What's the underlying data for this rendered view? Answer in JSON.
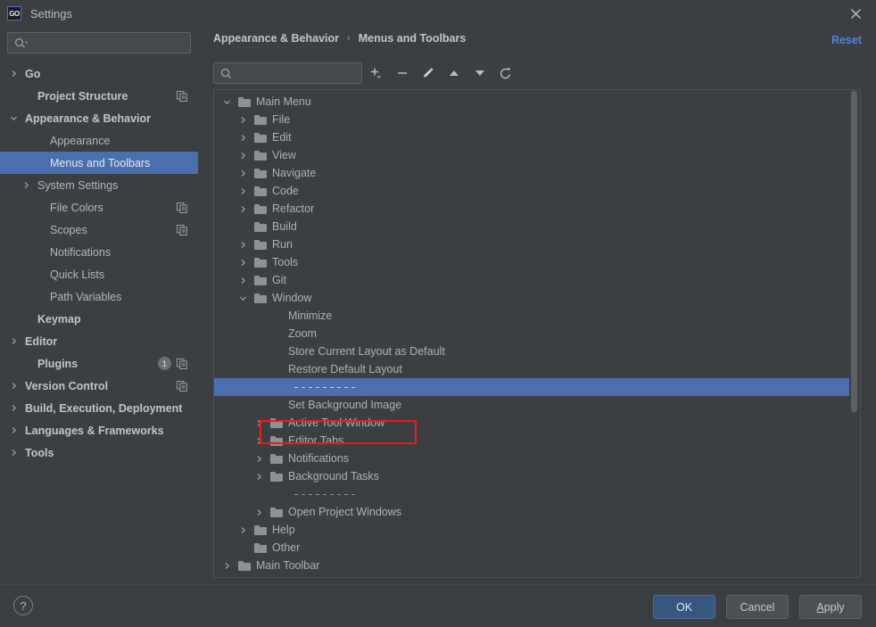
{
  "window": {
    "title": "Settings",
    "app_icon": "GO",
    "close_icon": "close-icon"
  },
  "sidebar": {
    "search": {
      "placeholder": "",
      "value": "",
      "icon": "search-icon"
    },
    "items": [
      {
        "label": "Go",
        "chevron": "right",
        "bold": true,
        "indent": 0,
        "selected": false,
        "copy": false,
        "badge": null
      },
      {
        "label": "Project Structure",
        "chevron": "none",
        "bold": true,
        "indent": 1,
        "selected": false,
        "copy": true,
        "badge": null
      },
      {
        "label": "Appearance & Behavior",
        "chevron": "down",
        "bold": true,
        "indent": 0,
        "selected": false,
        "copy": false,
        "badge": null
      },
      {
        "label": "Appearance",
        "chevron": "none",
        "bold": false,
        "indent": 2,
        "selected": false,
        "copy": false,
        "badge": null
      },
      {
        "label": "Menus and Toolbars",
        "chevron": "none",
        "bold": false,
        "indent": 2,
        "selected": true,
        "copy": false,
        "badge": null
      },
      {
        "label": "System Settings",
        "chevron": "right",
        "bold": false,
        "indent": 1,
        "selected": false,
        "copy": false,
        "badge": null
      },
      {
        "label": "File Colors",
        "chevron": "none",
        "bold": false,
        "indent": 2,
        "selected": false,
        "copy": true,
        "badge": null
      },
      {
        "label": "Scopes",
        "chevron": "none",
        "bold": false,
        "indent": 2,
        "selected": false,
        "copy": true,
        "badge": null
      },
      {
        "label": "Notifications",
        "chevron": "none",
        "bold": false,
        "indent": 2,
        "selected": false,
        "copy": false,
        "badge": null
      },
      {
        "label": "Quick Lists",
        "chevron": "none",
        "bold": false,
        "indent": 2,
        "selected": false,
        "copy": false,
        "badge": null
      },
      {
        "label": "Path Variables",
        "chevron": "none",
        "bold": false,
        "indent": 2,
        "selected": false,
        "copy": false,
        "badge": null
      },
      {
        "label": "Keymap",
        "chevron": "none",
        "bold": true,
        "indent": 1,
        "selected": false,
        "copy": false,
        "badge": null
      },
      {
        "label": "Editor",
        "chevron": "right",
        "bold": true,
        "indent": 0,
        "selected": false,
        "copy": false,
        "badge": null
      },
      {
        "label": "Plugins",
        "chevron": "none",
        "bold": true,
        "indent": 1,
        "selected": false,
        "copy": true,
        "badge": "1"
      },
      {
        "label": "Version Control",
        "chevron": "right",
        "bold": true,
        "indent": 0,
        "selected": false,
        "copy": true,
        "badge": null
      },
      {
        "label": "Build, Execution, Deployment",
        "chevron": "right",
        "bold": true,
        "indent": 0,
        "selected": false,
        "copy": false,
        "badge": null
      },
      {
        "label": "Languages & Frameworks",
        "chevron": "right",
        "bold": true,
        "indent": 0,
        "selected": false,
        "copy": false,
        "badge": null
      },
      {
        "label": "Tools",
        "chevron": "right",
        "bold": true,
        "indent": 0,
        "selected": false,
        "copy": false,
        "badge": null
      }
    ]
  },
  "main": {
    "breadcrumb": {
      "root": "Appearance & Behavior",
      "separator": "›",
      "current": "Menus and Toolbars"
    },
    "reset_label": "Reset",
    "toolbar": {
      "search": {
        "placeholder": "",
        "value": "",
        "icon": "search-icon"
      },
      "buttons": [
        {
          "name": "add-button",
          "icon": "plus-dropdown-icon"
        },
        {
          "name": "remove-button",
          "icon": "minus-icon"
        },
        {
          "name": "edit-button",
          "icon": "pencil-icon"
        },
        {
          "name": "move-up-button",
          "icon": "arrow-up-icon"
        },
        {
          "name": "move-down-button",
          "icon": "arrow-down-icon"
        },
        {
          "name": "restore-button",
          "icon": "revert-icon"
        }
      ]
    },
    "tree": [
      {
        "label": "Main Menu",
        "chevron": "down",
        "indent": 0,
        "folder": true,
        "separator": false,
        "selected": false
      },
      {
        "label": "File",
        "chevron": "right",
        "indent": 1,
        "folder": true,
        "separator": false,
        "selected": false
      },
      {
        "label": "Edit",
        "chevron": "right",
        "indent": 1,
        "folder": true,
        "separator": false,
        "selected": false
      },
      {
        "label": "View",
        "chevron": "right",
        "indent": 1,
        "folder": true,
        "separator": false,
        "selected": false
      },
      {
        "label": "Navigate",
        "chevron": "right",
        "indent": 1,
        "folder": true,
        "separator": false,
        "selected": false
      },
      {
        "label": "Code",
        "chevron": "right",
        "indent": 1,
        "folder": true,
        "separator": false,
        "selected": false
      },
      {
        "label": "Refactor",
        "chevron": "right",
        "indent": 1,
        "folder": true,
        "separator": false,
        "selected": false
      },
      {
        "label": "Build",
        "chevron": "none",
        "indent": 1,
        "folder": true,
        "separator": false,
        "selected": false
      },
      {
        "label": "Run",
        "chevron": "right",
        "indent": 1,
        "folder": true,
        "separator": false,
        "selected": false
      },
      {
        "label": "Tools",
        "chevron": "right",
        "indent": 1,
        "folder": true,
        "separator": false,
        "selected": false
      },
      {
        "label": "Git",
        "chevron": "right",
        "indent": 1,
        "folder": true,
        "separator": false,
        "selected": false
      },
      {
        "label": "Window",
        "chevron": "down",
        "indent": 1,
        "folder": true,
        "separator": false,
        "selected": false
      },
      {
        "label": "Minimize",
        "chevron": "none",
        "indent": 2,
        "folder": false,
        "separator": false,
        "selected": false
      },
      {
        "label": "Zoom",
        "chevron": "none",
        "indent": 2,
        "folder": false,
        "separator": false,
        "selected": false
      },
      {
        "label": "Store Current Layout as Default",
        "chevron": "none",
        "indent": 2,
        "folder": false,
        "separator": false,
        "selected": false
      },
      {
        "label": "Restore Default Layout",
        "chevron": "none",
        "indent": 2,
        "folder": false,
        "separator": false,
        "selected": false
      },
      {
        "label": "",
        "chevron": "none",
        "indent": 2,
        "folder": false,
        "separator": true,
        "selected": true
      },
      {
        "label": "Set Background Image",
        "chevron": "none",
        "indent": 2,
        "folder": false,
        "separator": false,
        "selected": false
      },
      {
        "label": "Active Tool Window",
        "chevron": "right",
        "indent": 2,
        "folder": true,
        "separator": false,
        "selected": false
      },
      {
        "label": "Editor Tabs",
        "chevron": "right",
        "indent": 2,
        "folder": true,
        "separator": false,
        "selected": false
      },
      {
        "label": "Notifications",
        "chevron": "right",
        "indent": 2,
        "folder": true,
        "separator": false,
        "selected": false
      },
      {
        "label": "Background Tasks",
        "chevron": "right",
        "indent": 2,
        "folder": true,
        "separator": false,
        "selected": false
      },
      {
        "label": "",
        "chevron": "none",
        "indent": 2,
        "folder": false,
        "separator": true,
        "selected": false
      },
      {
        "label": "Open Project Windows",
        "chevron": "right",
        "indent": 2,
        "folder": true,
        "separator": false,
        "selected": false
      },
      {
        "label": "Help",
        "chevron": "right",
        "indent": 1,
        "folder": true,
        "separator": false,
        "selected": false
      },
      {
        "label": "Other",
        "chevron": "none",
        "indent": 1,
        "folder": true,
        "separator": false,
        "selected": false
      },
      {
        "label": "Main Toolbar",
        "chevron": "right",
        "indent": 0,
        "folder": true,
        "separator": false,
        "selected": false
      }
    ],
    "annotation": {
      "name": "red-highlight-box",
      "target": "Set Background Image",
      "color": "#ef1b1b"
    }
  },
  "footer": {
    "help_label": "?",
    "ok_label": "OK",
    "cancel_label": "Cancel",
    "apply_mnemonic": "A",
    "apply_rest": "pply"
  },
  "colors": {
    "accent_selection": "#4b6eaf",
    "link": "#4e86d6",
    "primary_button": "#365880",
    "annotation": "#ef1b1b",
    "background": "#3c3f41"
  }
}
